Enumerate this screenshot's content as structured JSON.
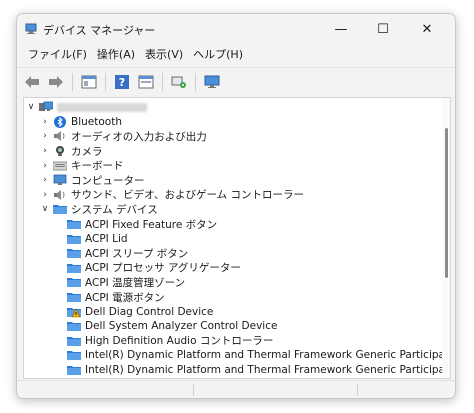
{
  "window": {
    "title": "デバイス マネージャー",
    "controls": {
      "minimize": "—",
      "maximize": "☐",
      "close": "✕"
    }
  },
  "menu": [
    "ファイル(F)",
    "操作(A)",
    "表示(V)",
    "ヘルプ(H)"
  ],
  "toolbar": [
    "back-arrow-icon",
    "forward-arrow-icon",
    "properties-icon",
    "help-icon",
    "view-icon",
    "scan-hardware-icon",
    "monitor-icon"
  ],
  "tree": {
    "root": {
      "expanded": true
    },
    "categories": [
      {
        "label": "Bluetooth",
        "icon": "bluetooth-icon"
      },
      {
        "label": "オーディオの入力および出力",
        "icon": "speaker-icon"
      },
      {
        "label": "カメラ",
        "icon": "camera-icon"
      },
      {
        "label": "キーボード",
        "icon": "keyboard-icon"
      },
      {
        "label": "コンピューター",
        "icon": "computer-icon"
      },
      {
        "label": "サウンド、ビデオ、およびゲーム コントローラー",
        "icon": "speaker-icon"
      }
    ],
    "system_devices": {
      "label": "システム デバイス",
      "expanded": true,
      "items": [
        {
          "label": "ACPI Fixed Feature ボタン",
          "warning": false
        },
        {
          "label": "ACPI Lid",
          "warning": false
        },
        {
          "label": "ACPI スリープ ボタン",
          "warning": false
        },
        {
          "label": "ACPI プロセッサ アグリゲーター",
          "warning": false
        },
        {
          "label": "ACPI 温度管理ゾーン",
          "warning": false
        },
        {
          "label": "ACPI 電源ボタン",
          "warning": false
        },
        {
          "label": "Dell Diag Control Device",
          "warning": true
        },
        {
          "label": "Dell System Analyzer Control Device",
          "warning": false
        },
        {
          "label": "High Definition Audio コントローラー",
          "warning": false
        },
        {
          "label": "Intel(R) Dynamic Platform and Thermal Framework Generic Participant",
          "warning": false
        },
        {
          "label": "Intel(R) Dynamic Platform and Thermal Framework Generic Participant",
          "warning": false
        }
      ]
    }
  },
  "colors": {
    "accent": "#1e6fd9",
    "folder_blue": "#2b7cd3",
    "warning": "#f0b400",
    "window_bg": "#f3f3f3"
  }
}
